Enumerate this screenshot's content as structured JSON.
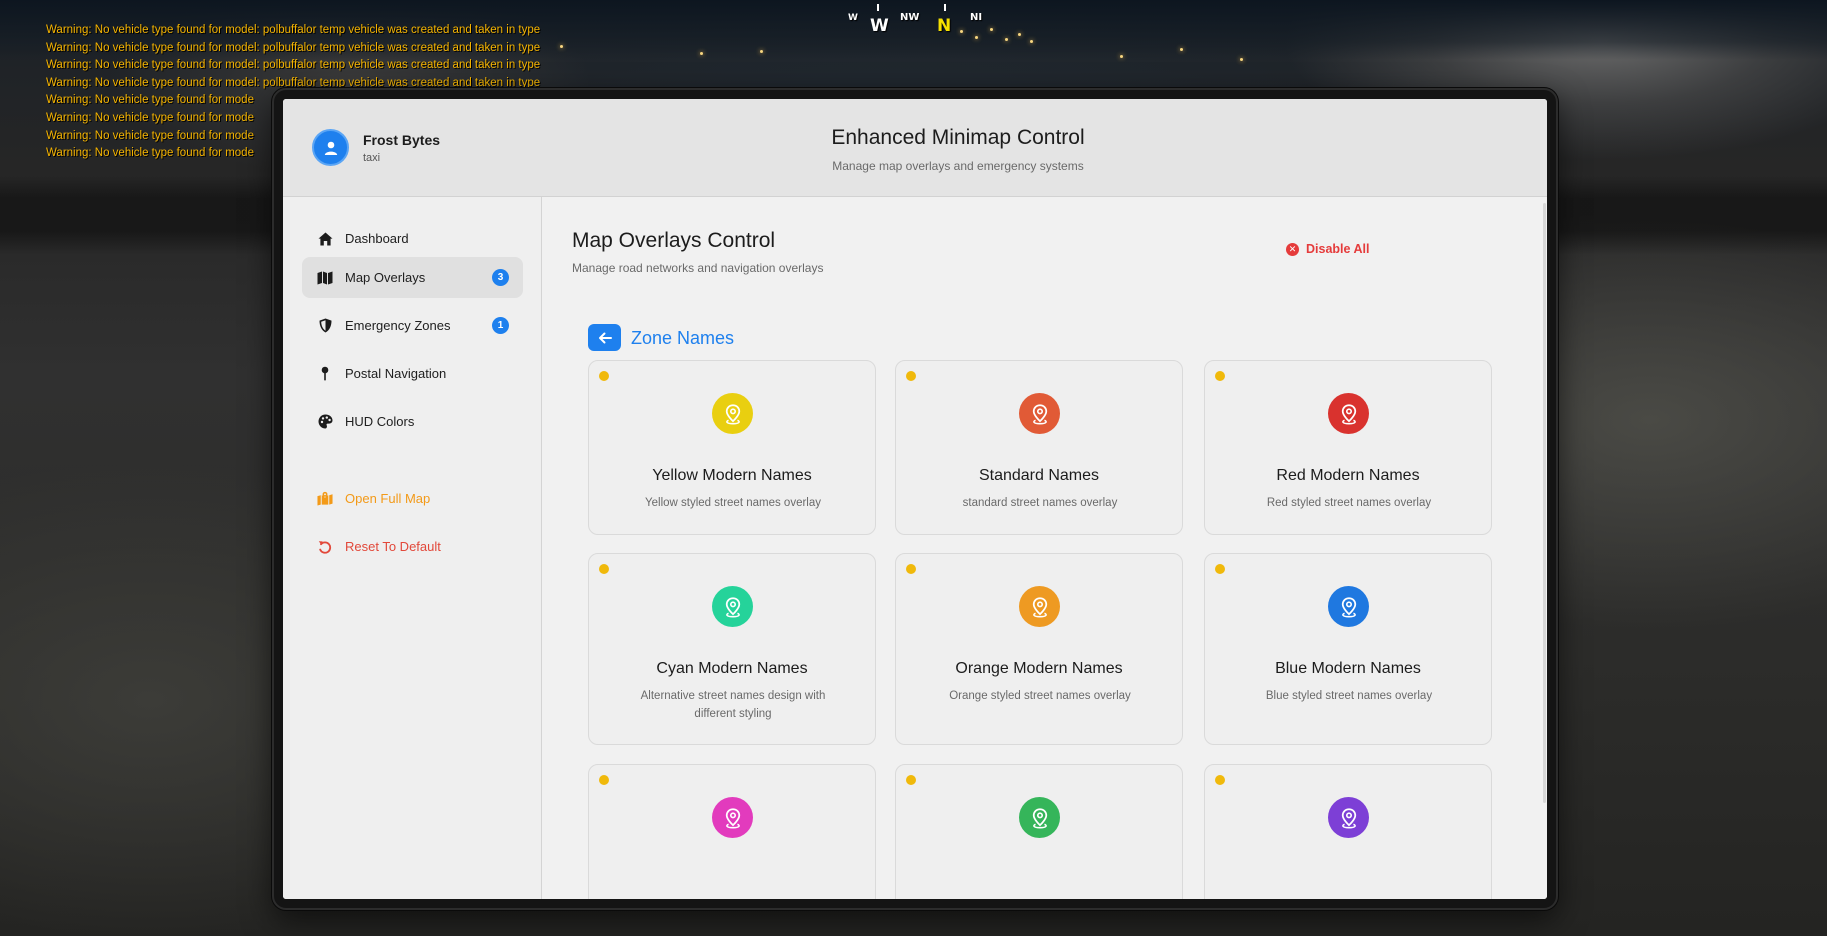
{
  "warnings": [
    "Warning: No vehicle type found for model: polbuffalor temp vehicle was created and taken in type",
    "Warning: No vehicle type found for model: polbuffalor temp vehicle was created and taken in type",
    "Warning: No vehicle type found for model: polbuffalor temp vehicle was created and taken in type",
    "Warning: No vehicle type found for model: polbuffalor temp vehicle was created and taken in type",
    "Warning: No vehicle type found for mode",
    "Warning: No vehicle type found for mode",
    "Warning: No vehicle type found for mode",
    "Warning: No vehicle type found for mode"
  ],
  "compass": {
    "labels": [
      "W",
      "W",
      "NW",
      "N",
      "NI"
    ],
    "highlight": "N"
  },
  "user": {
    "name": "Frost Bytes",
    "role": "taxi",
    "avatar_icon": "user-icon"
  },
  "app": {
    "title": "Enhanced Minimap Control",
    "subtitle": "Manage map overlays and emergency systems"
  },
  "sidebar": {
    "items": [
      {
        "label": "Dashboard",
        "icon": "home-icon",
        "badge": null,
        "active": false
      },
      {
        "label": "Map Overlays",
        "icon": "map-icon",
        "badge": "3",
        "active": true
      },
      {
        "label": "Emergency Zones",
        "icon": "shield-icon",
        "badge": "1",
        "active": false
      },
      {
        "label": "Postal Navigation",
        "icon": "pin-icon",
        "badge": null,
        "active": false
      },
      {
        "label": "HUD Colors",
        "icon": "palette-icon",
        "badge": null,
        "active": false
      }
    ],
    "actions": [
      {
        "label": "Open Full Map",
        "icon": "map-marked-icon",
        "color": "#f39a18"
      },
      {
        "label": "Reset To Default",
        "icon": "undo-icon",
        "color": "#e2483a"
      }
    ]
  },
  "main": {
    "title": "Map Overlays Control",
    "subtitle": "Manage road networks and navigation overlays",
    "disable_all_label": "Disable All",
    "section_title": "Zone Names",
    "back_icon": "arrow-left-icon"
  },
  "cards": [
    {
      "name": "Yellow Modern Names",
      "description": "Yellow styled street names overlay",
      "color": "#e9cf10",
      "status": "on"
    },
    {
      "name": "Standard Names",
      "description": "standard street names overlay",
      "color": "#e15a36",
      "status": "on"
    },
    {
      "name": "Red Modern Names",
      "description": "Red styled street names overlay",
      "color": "#d9322e",
      "status": "on"
    },
    {
      "name": "Cyan Modern Names",
      "description": "Alternative street names design with different styling",
      "color": "#25d39a",
      "status": "on"
    },
    {
      "name": "Orange Modern Names",
      "description": "Orange styled street names overlay",
      "color": "#ee9a22",
      "status": "on"
    },
    {
      "name": "Blue Modern Names",
      "description": "Blue styled street names overlay",
      "color": "#1f78e0",
      "status": "on"
    },
    {
      "name": "",
      "description": "",
      "color": "#e23bbd",
      "status": "on"
    },
    {
      "name": "",
      "description": "",
      "color": "#35b55a",
      "status": "on"
    },
    {
      "name": "",
      "description": "",
      "color": "#7d3fd6",
      "status": "on"
    }
  ],
  "colors": {
    "accent": "#1e80ee",
    "status_dot": "#f0b90b",
    "danger": "#e53b3b"
  }
}
